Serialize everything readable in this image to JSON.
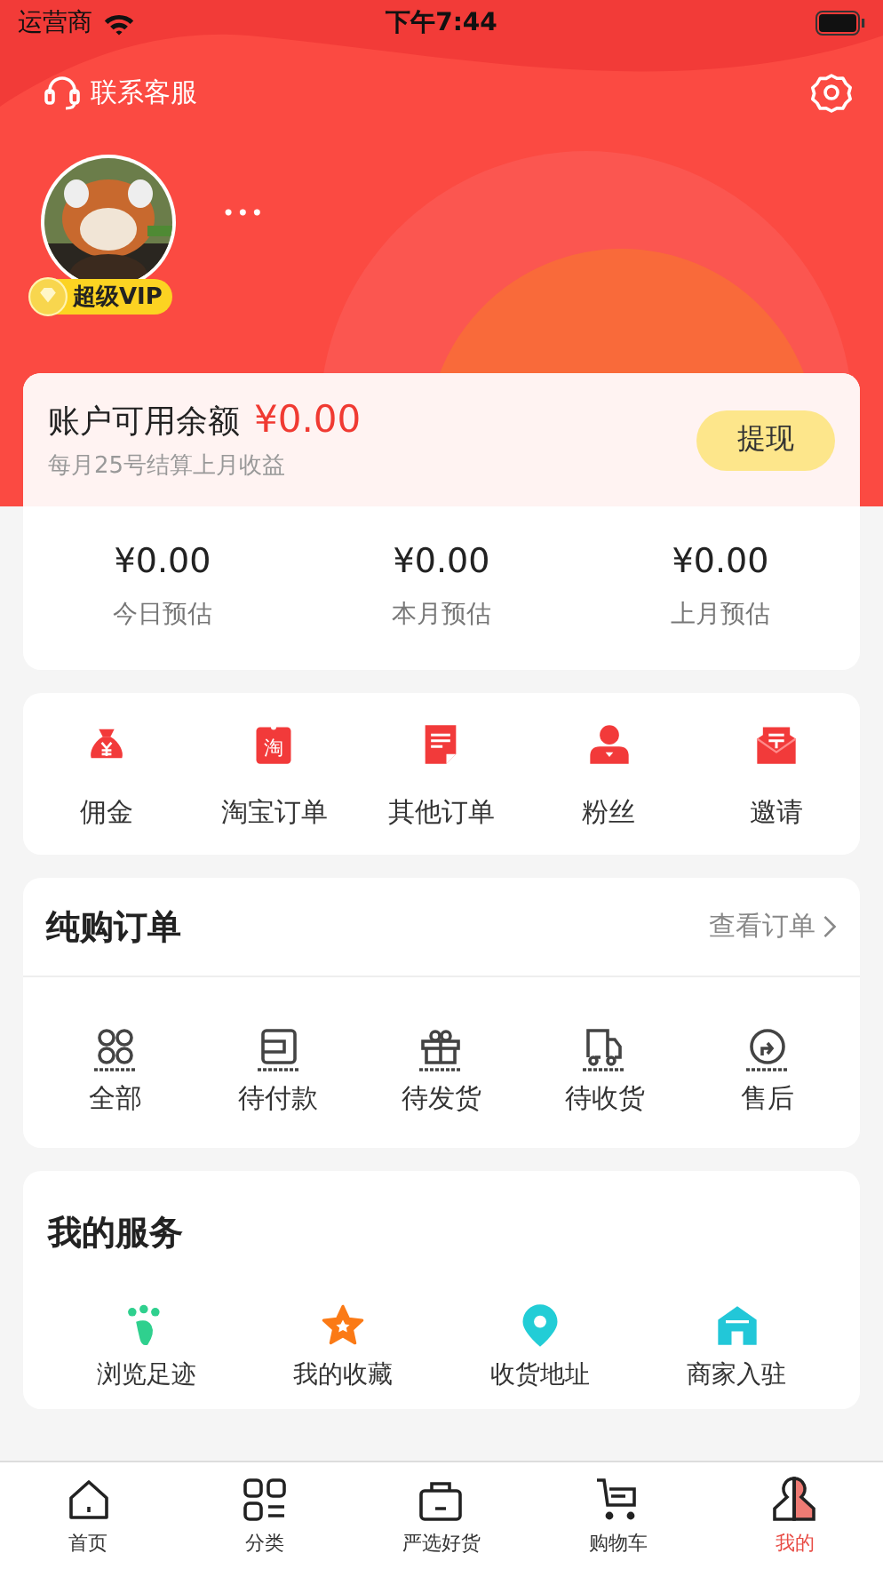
{
  "status_bar": {
    "carrier": "运营商",
    "time": "下午7:44"
  },
  "header": {
    "support_label": "联系客服",
    "more": "•••",
    "vip_label": "超级VIP"
  },
  "balance": {
    "label": "账户可用余额",
    "amount": "¥0.00",
    "note": "每月25号结算上月收益",
    "withdraw_button": "提现"
  },
  "estimates": [
    {
      "amount": "¥0.00",
      "label": "今日预估"
    },
    {
      "amount": "¥0.00",
      "label": "本月预估"
    },
    {
      "amount": "¥0.00",
      "label": "上月预估"
    }
  ],
  "quick_links": [
    {
      "kind": "moneybag",
      "label": "佣金"
    },
    {
      "kind": "taobao",
      "label": "淘宝订单",
      "glyph": "淘"
    },
    {
      "kind": "document",
      "label": "其他订单"
    },
    {
      "kind": "person",
      "label": "粉丝"
    },
    {
      "kind": "envelope",
      "label": "邀请"
    }
  ],
  "orders": {
    "title": "纯购订单",
    "view_all": "查看订单",
    "statuses": [
      {
        "kind": "clover",
        "label": "全部"
      },
      {
        "kind": "wallet",
        "label": "待付款"
      },
      {
        "kind": "gift",
        "label": "待发货"
      },
      {
        "kind": "truck",
        "label": "待收货"
      },
      {
        "kind": "return",
        "label": "售后"
      }
    ]
  },
  "services": {
    "title": "我的服务",
    "items": [
      {
        "kind": "footprint",
        "label": "浏览足迹"
      },
      {
        "kind": "star",
        "label": "我的收藏"
      },
      {
        "kind": "pin",
        "label": "收货地址"
      },
      {
        "kind": "shop",
        "label": "商家入驻"
      }
    ]
  },
  "tab_bar": [
    {
      "kind": "home",
      "label": "首页",
      "selected": false
    },
    {
      "kind": "grid",
      "label": "分类",
      "selected": false
    },
    {
      "kind": "bag",
      "label": "严选好货",
      "selected": false
    },
    {
      "kind": "cart",
      "label": "购物车",
      "selected": false
    },
    {
      "kind": "me",
      "label": "我的",
      "selected": true
    }
  ]
}
